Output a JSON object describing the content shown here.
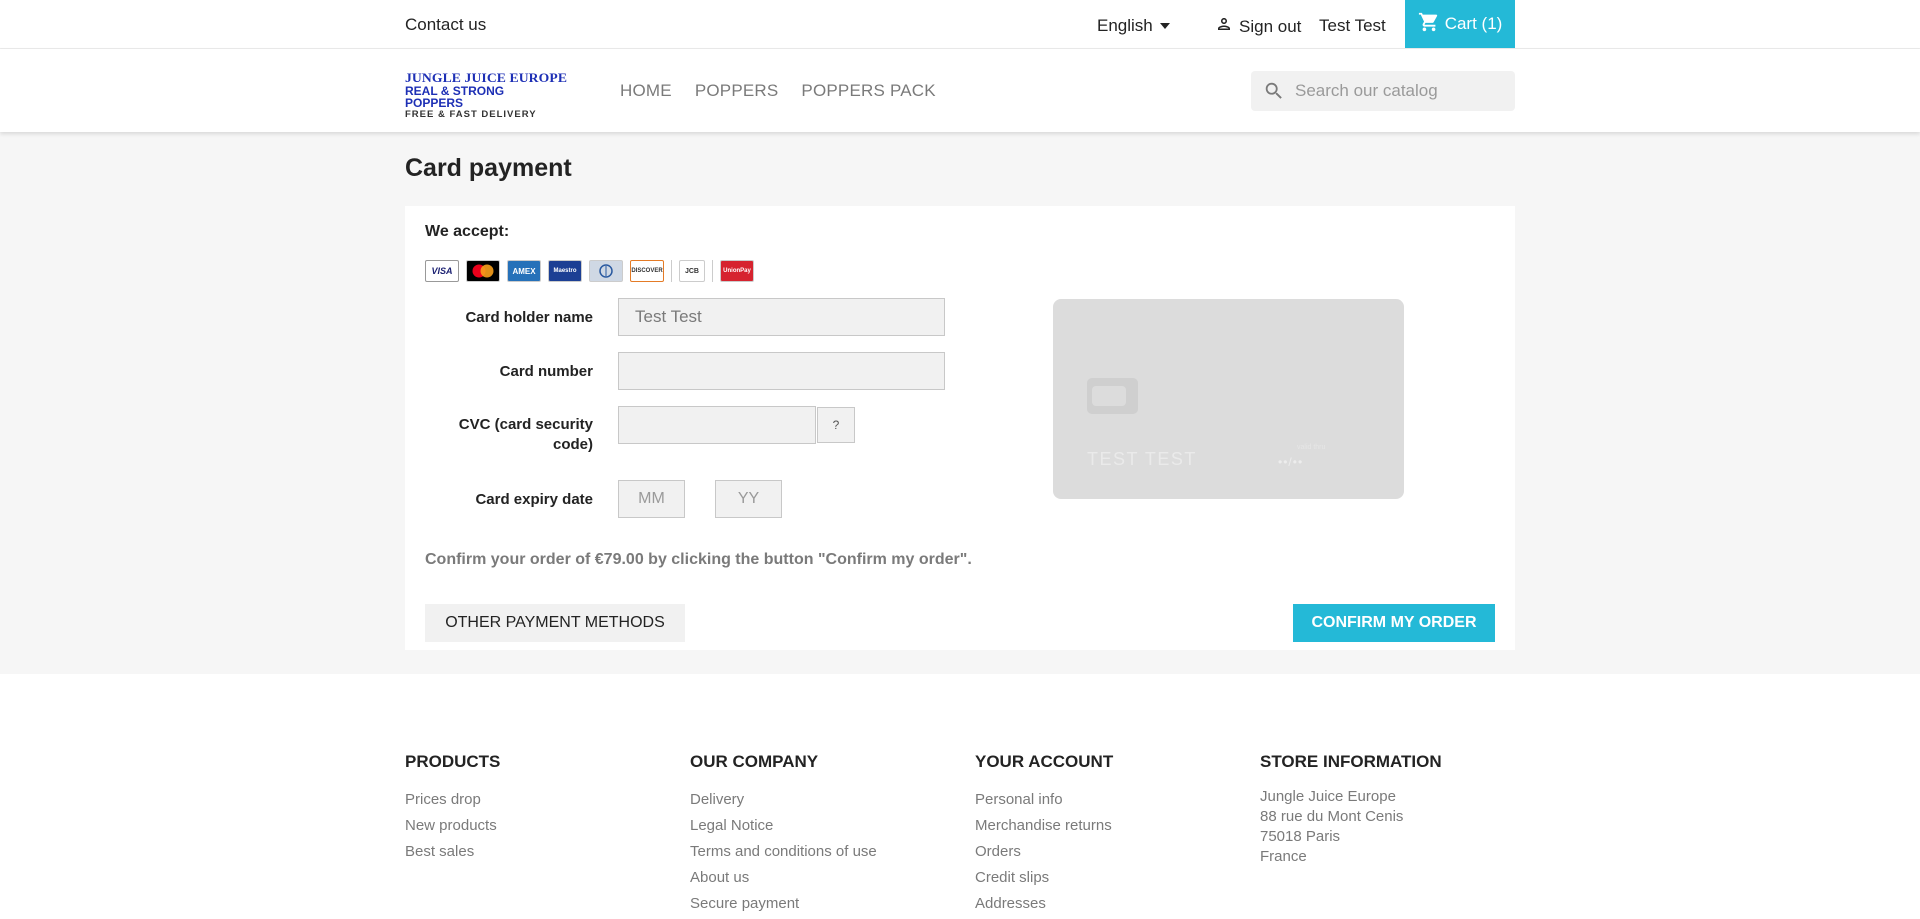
{
  "topbar": {
    "contact": "Contact us",
    "language": "English",
    "signout": "Sign out",
    "user_name": "Test Test",
    "cart": "Cart (1)"
  },
  "header": {
    "logo": {
      "line1": "JUNGLE JUICE EUROPE",
      "line2": "REAL & STRONG POPPERS",
      "line3": "FREE & FAST DELIVERY"
    },
    "nav": [
      "HOME",
      "POPPERS",
      "POPPERS PACK"
    ],
    "search_placeholder": "Search our catalog"
  },
  "main": {
    "title": "Card payment",
    "accept_label": "We accept:",
    "card_logos": [
      "VISA",
      "MasterCard",
      "AMEX",
      "Maestro",
      "Diners",
      "DISCOVER",
      "JCB",
      "UnionPay"
    ],
    "form": {
      "holder_label": "Card holder name",
      "holder_placeholder": "Test Test",
      "number_label": "Card number",
      "cvc_label": "CVC (card security code)",
      "cvc_help": "?",
      "expiry_label": "Card expiry date",
      "mm_placeholder": "MM",
      "yy_placeholder": "YY"
    },
    "card_preview": {
      "holder": "TEST TEST",
      "valid_label": "valid thru",
      "valid": "••/••"
    },
    "confirm_text": "Confirm your order of €79.00 by clicking the button \"Confirm my order\".",
    "btn_other": "OTHER PAYMENT METHODS",
    "btn_confirm": "CONFIRM MY ORDER"
  },
  "footer": {
    "products": {
      "title": "PRODUCTS",
      "links": [
        "Prices drop",
        "New products",
        "Best sales"
      ]
    },
    "company": {
      "title": "OUR COMPANY",
      "links": [
        "Delivery",
        "Legal Notice",
        "Terms and conditions of use",
        "About us",
        "Secure payment"
      ]
    },
    "account": {
      "title": "YOUR ACCOUNT",
      "links": [
        "Personal info",
        "Merchandise returns",
        "Orders",
        "Credit slips",
        "Addresses"
      ]
    },
    "store": {
      "title": "STORE INFORMATION",
      "lines": [
        "Jungle Juice Europe",
        "88 rue du Mont Cenis",
        "75018 Paris",
        "France"
      ]
    }
  },
  "colors": {
    "accent": "#24b9d7",
    "page_bg": "#f6f6f6",
    "text": "#232323",
    "muted": "#7a7a7a"
  }
}
